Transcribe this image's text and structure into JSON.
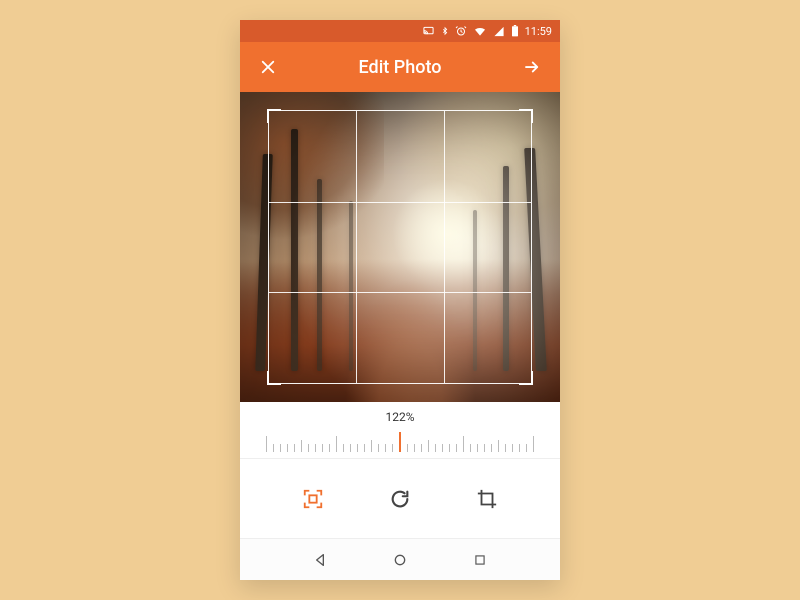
{
  "status": {
    "time": "11:59"
  },
  "header": {
    "title": "Edit Photo"
  },
  "zoom": {
    "percent_label": "122%"
  },
  "tools": {
    "frame_label": "frame",
    "rotate_label": "rotate",
    "crop_label": "crop"
  },
  "colors": {
    "accent": "#f0702f",
    "accent_dark": "#d85a2b"
  }
}
